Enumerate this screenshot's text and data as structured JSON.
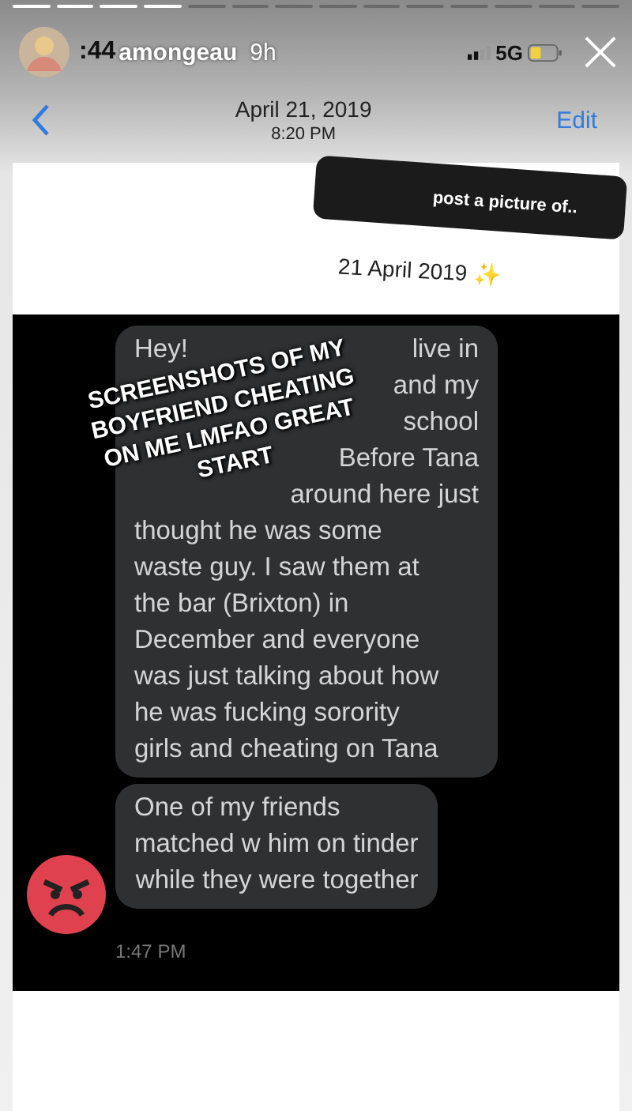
{
  "story": {
    "segments": [
      {
        "viewed": true
      },
      {
        "viewed": true
      },
      {
        "viewed": true
      },
      {
        "viewed": true
      },
      {
        "viewed": false
      },
      {
        "viewed": false
      },
      {
        "viewed": false
      },
      {
        "viewed": false
      },
      {
        "viewed": false
      },
      {
        "viewed": false
      },
      {
        "viewed": false
      },
      {
        "viewed": false
      },
      {
        "viewed": false
      },
      {
        "viewed": false
      }
    ],
    "username": "amongeau",
    "age": "9h"
  },
  "status_bar": {
    "time": ":44",
    "network": "5G"
  },
  "header": {
    "date": "April 21, 2019",
    "time": "8:20 PM",
    "action": "Edit"
  },
  "question_sticker": "post a picture of..",
  "caption_date": "21 April 2019 ✨",
  "overlay_caption": [
    "SCREENSHOTS OF MY",
    "BOYFRIEND CHEATING",
    "ON ME LMFAO GREAT",
    "START"
  ],
  "messages": [
    {
      "lines": [
        [
          "Hey!",
          "live in"
        ],
        [
          "and my"
        ],
        [
          "school"
        ],
        [
          "Before Tana"
        ],
        [
          "around here just"
        ],
        [
          "thought he was some"
        ],
        [
          "waste guy. I saw them at"
        ],
        [
          "the bar (Brixton) in"
        ],
        [
          "December and everyone"
        ],
        [
          "was just talking about how"
        ],
        [
          "he was fucking sorority"
        ],
        [
          "girls and cheating on Tana"
        ]
      ]
    },
    {
      "lines": [
        [
          "One of my friends"
        ],
        [
          "matched w him on tinder"
        ],
        [
          "while they were together"
        ]
      ]
    }
  ],
  "message_time": "1:47 PM"
}
